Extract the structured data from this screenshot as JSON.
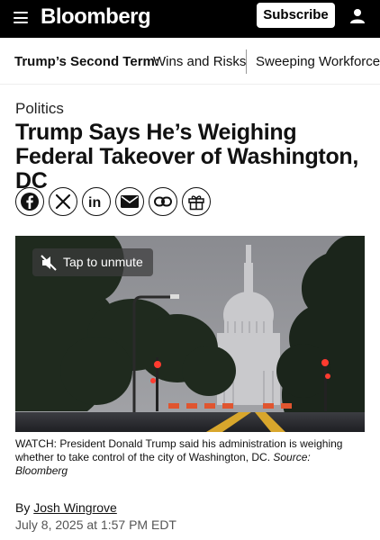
{
  "header": {
    "brand": "Bloomberg",
    "subscribe_label": "Subscribe",
    "menu_icon": "hamburger-menu-icon",
    "account_icon": "user-icon"
  },
  "topics": {
    "label": "Trump’s Second Term:",
    "link1": "Wins and Risks",
    "link2": "Sweeping Workforce C"
  },
  "article": {
    "section": "Politics",
    "headline": "Trump Says He’s Weighing Federal Takeover of Washington, DC",
    "share_icons": [
      "facebook-icon",
      "x-icon",
      "linkedin-icon",
      "email-icon",
      "link-icon",
      "gift-icon"
    ],
    "video": {
      "unmute_label": "Tap to unmute"
    },
    "caption": "WATCH: President Donald Trump said his administration is weighing whether to take control of the city of Washington, DC.",
    "caption_source": "Source: Bloomberg",
    "byline_prefix": "By ",
    "author": "Josh Wingrove",
    "date": "July 8, 2025 at 1:57 PM EDT"
  },
  "colors": {
    "header_bg": "#000000",
    "text": "#111111",
    "muted": "#555555"
  }
}
